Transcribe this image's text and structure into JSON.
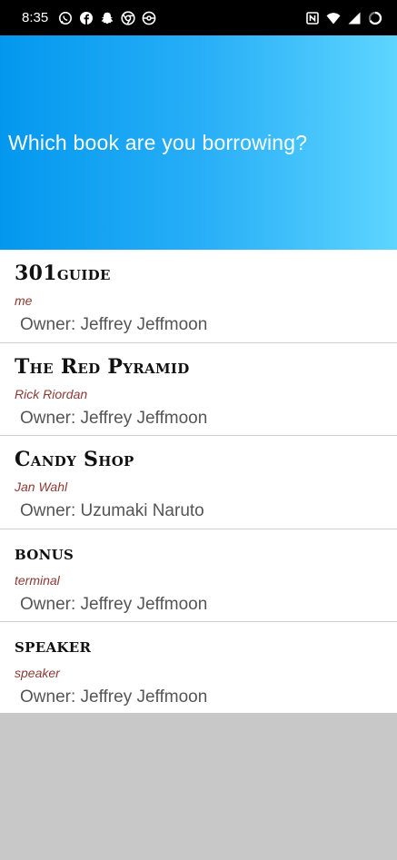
{
  "status_bar": {
    "time": "8:35",
    "left_icons": [
      "whatsapp-icon",
      "facebook-icon",
      "snapchat-icon",
      "chrome-icon",
      "pokeball-icon"
    ],
    "right_icons": [
      "nfc-icon",
      "wifi-icon",
      "cell-signal-icon",
      "battery-icon"
    ]
  },
  "header": {
    "title": "Which book are you borrowing?",
    "gradient": [
      "#0398ee",
      "#5dd5fe"
    ]
  },
  "books": [
    {
      "title": "301guide",
      "author": "me",
      "owner": "Owner: Jeffrey Jeffmoon"
    },
    {
      "title": "The Red Pyramid",
      "author": "Rick Riordan",
      "owner": "Owner: Jeffrey Jeffmoon"
    },
    {
      "title": "Candy Shop",
      "author": "Jan Wahl",
      "owner": "Owner: Uzumaki Naruto"
    },
    {
      "title": "bonus",
      "author": "terminal",
      "owner": "Owner: Jeffrey Jeffmoon"
    },
    {
      "title": "speaker",
      "author": "speaker",
      "owner": "Owner: Jeffrey Jeffmoon"
    }
  ],
  "colors": {
    "author_text": "#8a3a34",
    "background_grey": "#c8c8c8"
  }
}
